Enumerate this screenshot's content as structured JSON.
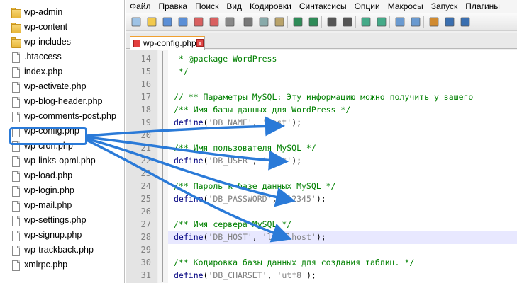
{
  "file_panel": {
    "items": [
      {
        "name": "wp-admin",
        "type": "folder"
      },
      {
        "name": "wp-content",
        "type": "folder"
      },
      {
        "name": "wp-includes",
        "type": "folder"
      },
      {
        "name": ".htaccess",
        "type": "file"
      },
      {
        "name": "index.php",
        "type": "file"
      },
      {
        "name": "wp-activate.php",
        "type": "file"
      },
      {
        "name": "wp-blog-header.php",
        "type": "file"
      },
      {
        "name": "wp-comments-post.php",
        "type": "file"
      },
      {
        "name": "wp-config.php",
        "type": "file",
        "selected": true
      },
      {
        "name": "wp-cron.php",
        "type": "file"
      },
      {
        "name": "wp-links-opml.php",
        "type": "file"
      },
      {
        "name": "wp-load.php",
        "type": "file"
      },
      {
        "name": "wp-login.php",
        "type": "file"
      },
      {
        "name": "wp-mail.php",
        "type": "file"
      },
      {
        "name": "wp-settings.php",
        "type": "file"
      },
      {
        "name": "wp-signup.php",
        "type": "file"
      },
      {
        "name": "wp-trackback.php",
        "type": "file"
      },
      {
        "name": "xmlrpc.php",
        "type": "file"
      }
    ]
  },
  "menu": {
    "items": [
      "Файл",
      "Правка",
      "Поиск",
      "Вид",
      "Кодировки",
      "Синтаксисы",
      "Опции",
      "Макросы",
      "Запуск",
      "Плагины"
    ]
  },
  "toolbar": {
    "icons": [
      "new-file-icon",
      "open-file-icon",
      "save-icon",
      "save-all-icon",
      "close-icon",
      "close-all-icon",
      "print-icon",
      "cut-icon",
      "copy-icon",
      "paste-icon",
      "undo-icon",
      "redo-icon",
      "find-icon",
      "replace-icon",
      "zoom-in-icon",
      "zoom-out-icon",
      "sync-vertical-icon",
      "sync-horizontal-icon",
      "word-wrap-icon",
      "show-all-chars-icon",
      "indent-guide-icon"
    ]
  },
  "tab": {
    "label": "wp-config.php",
    "close": "x"
  },
  "code": {
    "lines": [
      {
        "no": "14",
        "parts": [
          {
            "t": " * @package WordPress",
            "c": "cmt"
          }
        ]
      },
      {
        "no": "15",
        "parts": [
          {
            "t": " */",
            "c": "cmt"
          }
        ]
      },
      {
        "no": "16",
        "parts": [
          {
            "t": "",
            "c": "op"
          }
        ]
      },
      {
        "no": "17",
        "parts": [
          {
            "t": "// ** Параметры MySQL: Эту информацию можно получить у вашего",
            "c": "cmt"
          }
        ]
      },
      {
        "no": "18",
        "parts": [
          {
            "t": "/** Имя базы данных для WordPress */",
            "c": "cmt"
          }
        ]
      },
      {
        "no": "19",
        "parts": [
          {
            "t": "define",
            "c": "kw"
          },
          {
            "t": "(",
            "c": "op"
          },
          {
            "t": "'DB_NAME'",
            "c": "str"
          },
          {
            "t": ", ",
            "c": "op"
          },
          {
            "t": "'test'",
            "c": "str"
          },
          {
            "t": ");",
            "c": "op"
          }
        ]
      },
      {
        "no": "20",
        "parts": [
          {
            "t": "",
            "c": "op"
          }
        ]
      },
      {
        "no": "21",
        "parts": [
          {
            "t": "/** Имя пользователя MySQL */",
            "c": "cmt"
          }
        ]
      },
      {
        "no": "22",
        "parts": [
          {
            "t": "define",
            "c": "kw"
          },
          {
            "t": "(",
            "c": "op"
          },
          {
            "t": "'DB_USER'",
            "c": "str"
          },
          {
            "t": ", ",
            "c": "op"
          },
          {
            "t": "'test'",
            "c": "str"
          },
          {
            "t": ");",
            "c": "op"
          }
        ]
      },
      {
        "no": "23",
        "parts": [
          {
            "t": "",
            "c": "op"
          }
        ]
      },
      {
        "no": "24",
        "parts": [
          {
            "t": "/** Пароль к базе данных MySQL */",
            "c": "cmt"
          }
        ]
      },
      {
        "no": "25",
        "parts": [
          {
            "t": "define",
            "c": "kw"
          },
          {
            "t": "(",
            "c": "op"
          },
          {
            "t": "'DB_PASSWORD'",
            "c": "str"
          },
          {
            "t": ", ",
            "c": "op"
          },
          {
            "t": "'12345'",
            "c": "str"
          },
          {
            "t": ");",
            "c": "op"
          }
        ]
      },
      {
        "no": "26",
        "parts": [
          {
            "t": "",
            "c": "op"
          }
        ]
      },
      {
        "no": "27",
        "parts": [
          {
            "t": "/** Имя сервера MySQL */",
            "c": "cmt"
          }
        ]
      },
      {
        "no": "28",
        "parts": [
          {
            "t": "define",
            "c": "kw"
          },
          {
            "t": "(",
            "c": "op"
          },
          {
            "t": "'DB_HOST'",
            "c": "str"
          },
          {
            "t": ", ",
            "c": "op"
          },
          {
            "t": "'localhost'",
            "c": "str"
          },
          {
            "t": ");",
            "c": "op"
          }
        ],
        "highlight": true
      },
      {
        "no": "29",
        "parts": [
          {
            "t": "",
            "c": "op"
          }
        ]
      },
      {
        "no": "30",
        "parts": [
          {
            "t": "/** Кодировка базы данных для создания таблиц. */",
            "c": "cmt"
          }
        ]
      },
      {
        "no": "31",
        "parts": [
          {
            "t": "define",
            "c": "kw"
          },
          {
            "t": "(",
            "c": "op"
          },
          {
            "t": "'DB_CHARSET'",
            "c": "str"
          },
          {
            "t": ", ",
            "c": "op"
          },
          {
            "t": "'utf8'",
            "c": "str"
          },
          {
            "t": ");",
            "c": "op"
          }
        ]
      }
    ]
  },
  "colors": {
    "arrow": "#2a7ad8",
    "comment": "#008000",
    "keyword": "#000080",
    "string": "#808080",
    "current_line": "#e8e8ff"
  }
}
